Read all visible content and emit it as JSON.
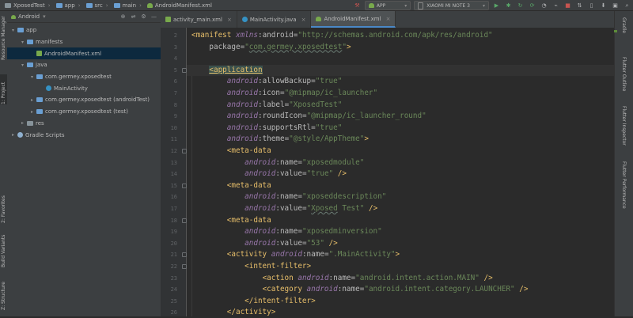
{
  "breadcrumbs": [
    {
      "label": "XposedTest",
      "icon": "folder-icon"
    },
    {
      "label": "app",
      "icon": "folder-icon"
    },
    {
      "label": "src",
      "icon": "folder-icon"
    },
    {
      "label": "main",
      "icon": "folder-icon"
    },
    {
      "label": "AndroidManifest.xml",
      "icon": "android-icon"
    }
  ],
  "toolbar": {
    "run_config": "APP",
    "device": "XIAOMI MI NOTE 3"
  },
  "left_tool_tabs": [
    "Resource Manager",
    "1: Project",
    "2: Favorites",
    "Build Variants",
    "Z: Structure"
  ],
  "right_tool_tabs": [
    "Gradle",
    "Flutter Outline",
    "Flutter Inspector",
    "Flutter Performance"
  ],
  "project_panel": {
    "view_mode": "Android",
    "tree": [
      {
        "label": "app",
        "indent": 0,
        "icon": "folder-icon",
        "expanded": true
      },
      {
        "label": "manifests",
        "indent": 1,
        "icon": "folder-icon",
        "expanded": true
      },
      {
        "label": "AndroidManifest.xml",
        "indent": 2,
        "icon": "xml-file-icon",
        "selected": true
      },
      {
        "label": "java",
        "indent": 1,
        "icon": "folder-icon",
        "expanded": true
      },
      {
        "label": "com.germey.xposedtest",
        "indent": 2,
        "icon": "package-icon",
        "expanded": true
      },
      {
        "label": "MainActivity",
        "indent": 3,
        "icon": "class-icon"
      },
      {
        "label": "com.germey.xposedtest (androidTest)",
        "indent": 2,
        "icon": "package-icon",
        "expanded": false
      },
      {
        "label": "com.germey.xposedtest (test)",
        "indent": 2,
        "icon": "package-icon",
        "expanded": false
      },
      {
        "label": "res",
        "indent": 1,
        "icon": "res-folder-icon",
        "expanded": false
      },
      {
        "label": "Gradle Scripts",
        "indent": 0,
        "icon": "gradle-icon",
        "expanded": false
      }
    ]
  },
  "editor_tabs": [
    {
      "label": "activity_main.xml",
      "icon": "xml-file-icon",
      "active": false
    },
    {
      "label": "MainActivity.java",
      "icon": "class-icon",
      "active": false
    },
    {
      "label": "AndroidManifest.xml",
      "icon": "android-icon",
      "active": true
    }
  ],
  "code": {
    "first_line_number": 2,
    "lines": [
      "<manifest xmlns:android=\"http://schemas.android.com/apk/res/android\"",
      "    package=\"com.germey.xposedtest\">",
      "",
      "    <application",
      "        android:allowBackup=\"true\"",
      "        android:icon=\"@mipmap/ic_launcher\"",
      "        android:label=\"XposedTest\"",
      "        android:roundIcon=\"@mipmap/ic_launcher_round\"",
      "        android:supportsRtl=\"true\"",
      "        android:theme=\"@style/AppTheme\">",
      "        <meta-data",
      "            android:name=\"xposedmodule\"",
      "            android:value=\"true\" />",
      "        <meta-data",
      "            android:name=\"xposeddescription\"",
      "            android:value=\"Xposed Test\" />",
      "        <meta-data",
      "            android:name=\"xposedminversion\"",
      "            android:value=\"53\" />",
      "        <activity android:name=\".MainActivity\">",
      "            <intent-filter>",
      "                <action android:name=\"android.intent.action.MAIN\" />",
      "                <category android:name=\"android.intent.category.LAUNCHER\" />",
      "            </intent-filter>",
      "        </activity>"
    ]
  },
  "colors": {
    "tag": "#e8bf6a",
    "namespace": "#9876aa",
    "attr_value": "#6a8759",
    "editor_bg": "#2b2b2b",
    "panel_bg": "#3c3f41",
    "selection": "#2f65ca"
  }
}
